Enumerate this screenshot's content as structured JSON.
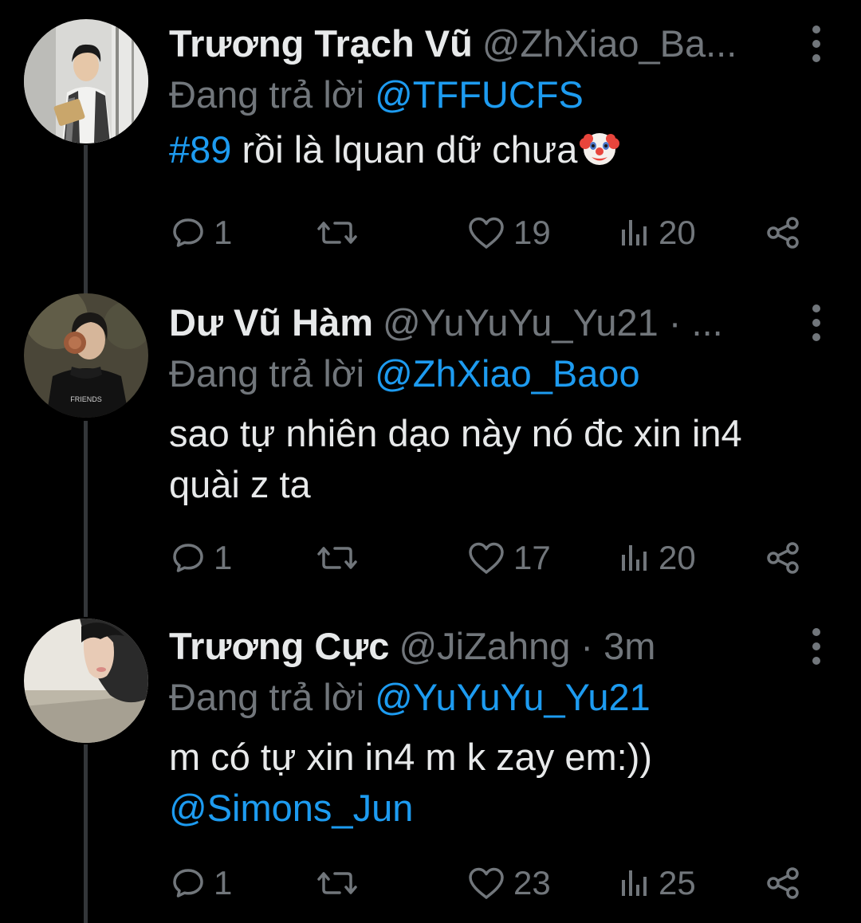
{
  "colors": {
    "background": "#000000",
    "text_primary": "#e7e9ea",
    "text_secondary": "#71767b",
    "accent": "#1d9bf0",
    "thread_line": "#333639"
  },
  "tweets": [
    {
      "display_name": "Trương Trạch Vũ",
      "handle_meta": "@ZhXiao_Ba...",
      "reply_prefix": "Đang trả lời",
      "reply_to": "@TFFUCFS",
      "body_hashtag": "#89",
      "body_text": "rồi là lquan dữ chưa",
      "emoji": "clown-face-icon",
      "replies": "1",
      "retweets": "",
      "likes": "19",
      "views": "20"
    },
    {
      "display_name": "Dư Vũ Hàm",
      "handle_meta": "@YuYuYu_Yu21 · ...",
      "reply_prefix": "Đang trả lời",
      "reply_to": "@ZhXiao_Baoo",
      "body_text_line1": "sao tự nhiên dạo này nó đc xin in4",
      "body_text_line2": "quài z ta",
      "replies": "1",
      "retweets": "",
      "likes": "17",
      "views": "20"
    },
    {
      "display_name": "Trương Cực",
      "handle_meta": "@JiZahng · 3m",
      "reply_prefix": "Đang trả lời",
      "reply_to": "@YuYuYu_Yu21",
      "body_text": "m có tự xin in4 m k zay em:))",
      "body_mention": "@Simons_Jun",
      "replies": "1",
      "retweets": "",
      "likes": "23",
      "views": "25"
    }
  ]
}
